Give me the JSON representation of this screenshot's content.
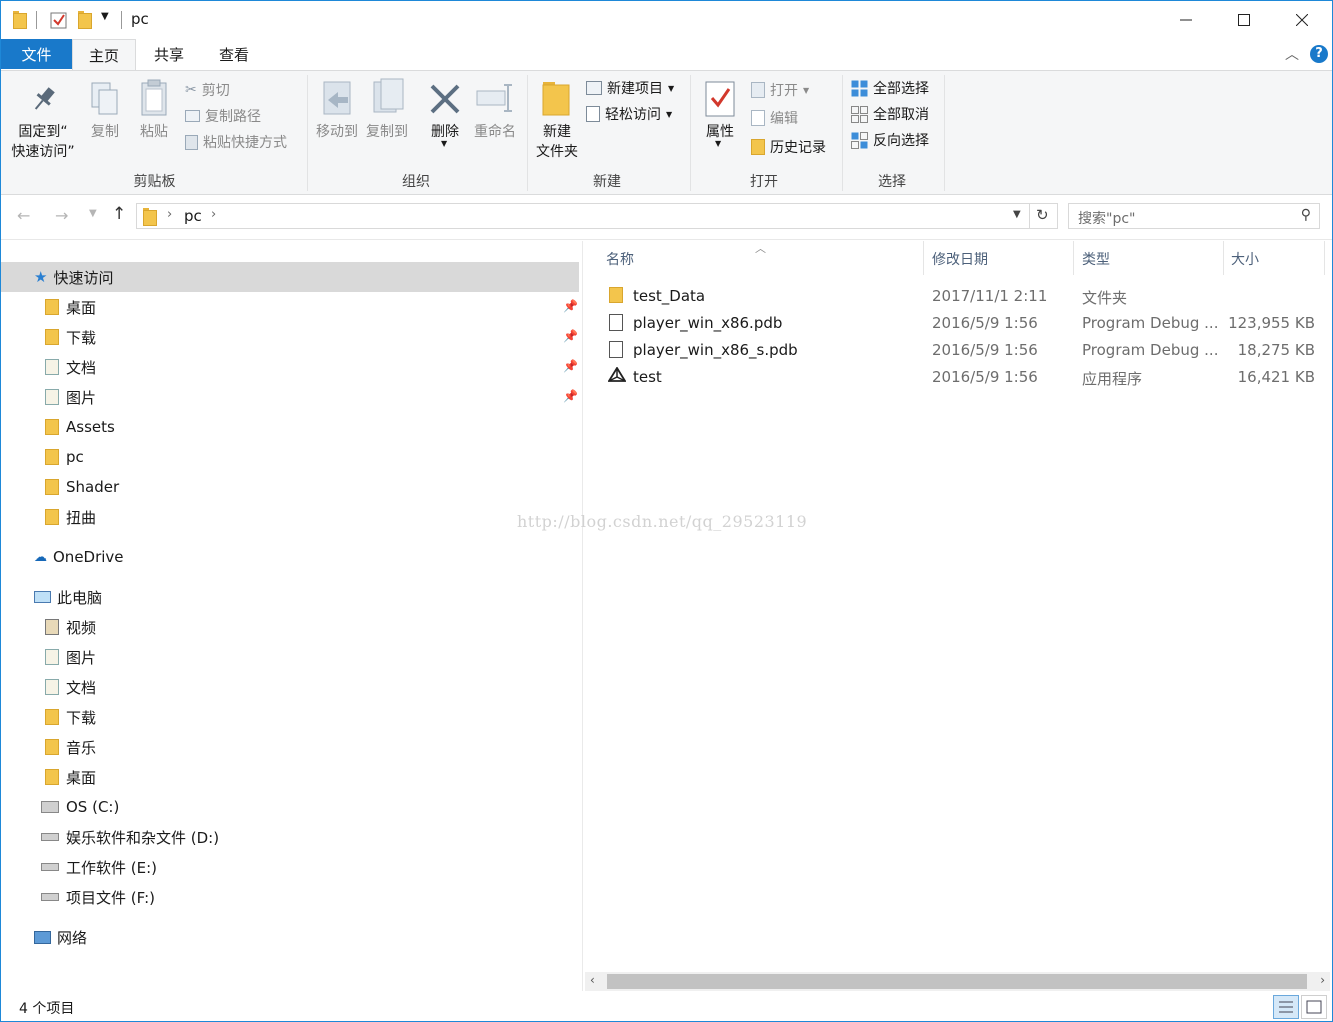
{
  "title_bar": {
    "title": "pc",
    "minimize": "—",
    "maximize": "☐",
    "close": "✕"
  },
  "tabs": [
    {
      "label": "文件"
    },
    {
      "label": "主页"
    },
    {
      "label": "共享"
    },
    {
      "label": "查看"
    }
  ],
  "ribbon": {
    "clipboard": {
      "pin": "固定到“\n快速访问”",
      "copy": "复制",
      "paste": "粘贴",
      "cut": "剪切",
      "copy_path": "复制路径",
      "paste_shortcut": "粘贴快捷方式",
      "label": "剪贴板"
    },
    "organize": {
      "move_to": "移动到",
      "copy_to": "复制到",
      "delete": "删除",
      "rename": "重命名",
      "label": "组织"
    },
    "new": {
      "new_folder": "新建\n文件夹",
      "new_item": "新建项目",
      "easy_access": "轻松访问",
      "label": "新建"
    },
    "open": {
      "properties": "属性",
      "open": "打开",
      "edit": "编辑",
      "history": "历史记录",
      "label": "打开"
    },
    "select": {
      "select_all": "全部选择",
      "select_none": "全部取消",
      "invert": "反向选择",
      "label": "选择"
    }
  },
  "address": {
    "crumb": "pc",
    "search_placeholder": "搜索\"pc\""
  },
  "nav": {
    "quick_access": "快速访问",
    "quick_items": [
      "桌面",
      "下载",
      "文档",
      "图片",
      "Assets",
      "pc",
      "Shader",
      "扭曲"
    ],
    "onedrive": "OneDrive",
    "this_pc": "此电脑",
    "pc_items": [
      "视频",
      "图片",
      "文档",
      "下载",
      "音乐",
      "桌面",
      "OS (C:)",
      "娱乐软件和杂文件 (D:)",
      "工作软件 (E:)",
      "项目文件 (F:)"
    ],
    "network": "网络"
  },
  "columns": {
    "name": "名称",
    "date": "修改日期",
    "type": "类型",
    "size": "大小"
  },
  "files": [
    {
      "name": "test_Data",
      "date": "2017/11/1 2:11",
      "type": "文件夹",
      "size": "",
      "icon": "folder-icon"
    },
    {
      "name": "player_win_x86.pdb",
      "date": "2016/5/9 1:56",
      "type": "Program Debug ...",
      "size": "123,955 KB",
      "icon": "pdb-file-icon"
    },
    {
      "name": "player_win_x86_s.pdb",
      "date": "2016/5/9 1:56",
      "type": "Program Debug ...",
      "size": "18,275 KB",
      "icon": "pdb-file-icon"
    },
    {
      "name": "test",
      "date": "2016/5/9 1:56",
      "type": "应用程序",
      "size": "16,421 KB",
      "icon": "unity-app-icon"
    }
  ],
  "watermark": "http://blog.csdn.net/qq_29523119",
  "status": {
    "count": "4 个项目"
  }
}
